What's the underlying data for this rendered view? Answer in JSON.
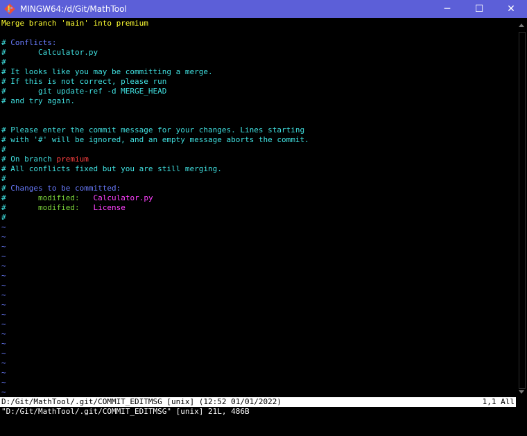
{
  "window": {
    "title": "MINGW64:/d/Git/MathTool",
    "minimize": "─",
    "maximize": "☐",
    "close": "✕"
  },
  "editor": {
    "lines": [
      [
        {
          "text": "Merge branch 'main' into premium",
          "color": "yellow"
        }
      ],
      [
        {
          "text": "",
          "color": "white"
        }
      ],
      [
        {
          "text": "# ",
          "color": "cyan"
        },
        {
          "text": "Conflicts:",
          "color": "blue"
        }
      ],
      [
        {
          "text": "#       Calculator.py",
          "color": "cyan"
        }
      ],
      [
        {
          "text": "#",
          "color": "cyan"
        }
      ],
      [
        {
          "text": "# It looks like you may be committing a merge.",
          "color": "cyan"
        }
      ],
      [
        {
          "text": "# If this is not correct, please run",
          "color": "cyan"
        }
      ],
      [
        {
          "text": "#       git update-ref -d MERGE_HEAD",
          "color": "cyan"
        }
      ],
      [
        {
          "text": "# and try again.",
          "color": "cyan"
        }
      ],
      [
        {
          "text": "",
          "color": "white"
        }
      ],
      [
        {
          "text": "",
          "color": "white"
        }
      ],
      [
        {
          "text": "# Please enter the commit message for your changes. Lines starting",
          "color": "cyan"
        }
      ],
      [
        {
          "text": "# with '#' will be ignored, and an empty message aborts the commit.",
          "color": "cyan"
        }
      ],
      [
        {
          "text": "#",
          "color": "cyan"
        }
      ],
      [
        {
          "text": "# On branch ",
          "color": "cyan"
        },
        {
          "text": "premium",
          "color": "red"
        }
      ],
      [
        {
          "text": "# All conflicts fixed but you are still merging.",
          "color": "cyan"
        }
      ],
      [
        {
          "text": "#",
          "color": "cyan"
        }
      ],
      [
        {
          "text": "# ",
          "color": "cyan"
        },
        {
          "text": "Changes to be committed:",
          "color": "blue"
        }
      ],
      [
        {
          "text": "#       ",
          "color": "cyan"
        },
        {
          "text": "modified:   ",
          "color": "green"
        },
        {
          "text": "Calculator.py",
          "color": "magenta"
        }
      ],
      [
        {
          "text": "#       ",
          "color": "cyan"
        },
        {
          "text": "modified:   ",
          "color": "green"
        },
        {
          "text": "License",
          "color": "magenta"
        }
      ],
      [
        {
          "text": "#",
          "color": "cyan"
        }
      ]
    ],
    "tilde_char": "~",
    "tilde_count": 18
  },
  "statusbar": {
    "left": "D:/Git/MathTool/.git/COMMIT_EDITMSG [unix] (12:52 01/01/2022)",
    "right": "1,1 All"
  },
  "cmdline": "\"D:/Git/MathTool/.git/COMMIT_EDITMSG\" [unix] 21L, 486B"
}
